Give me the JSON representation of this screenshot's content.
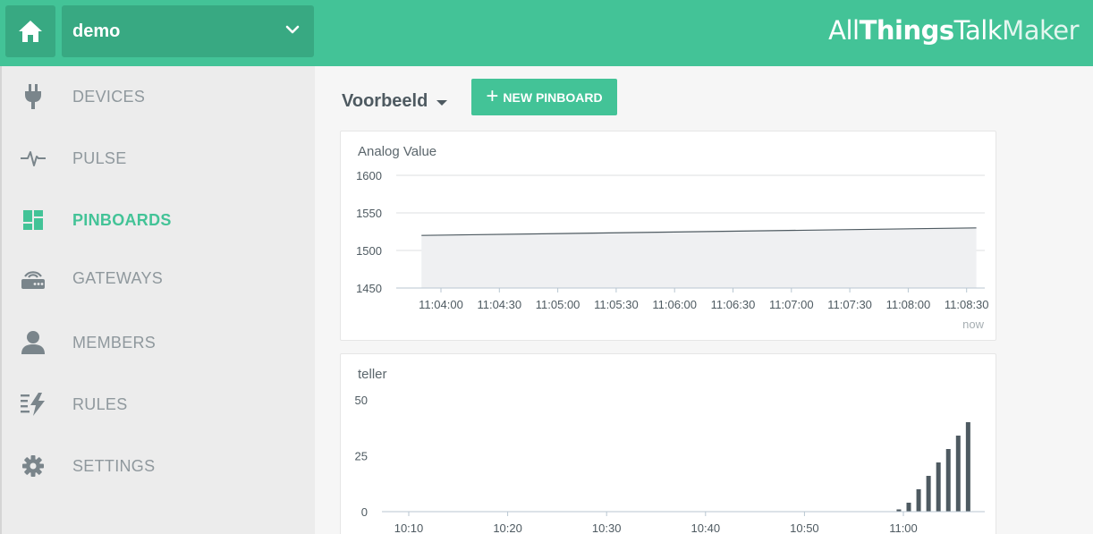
{
  "header": {
    "ground": "demo",
    "brand": {
      "part1": "All",
      "part2": "Things",
      "part3": "Talk",
      "part4": "Maker"
    },
    "brand_color": "#43c397"
  },
  "sidebar": {
    "items": [
      {
        "label": "DEVICES",
        "icon": "plug-icon",
        "active": false
      },
      {
        "label": "PULSE",
        "icon": "pulse-icon",
        "active": false
      },
      {
        "label": "PINBOARDS",
        "icon": "dashboard-icon",
        "active": true
      },
      {
        "label": "GATEWAYS",
        "icon": "gateway-icon",
        "active": false
      },
      {
        "label": "MEMBERS",
        "icon": "user-icon",
        "active": false
      },
      {
        "label": "RULES",
        "icon": "rules-icon",
        "active": false
      },
      {
        "label": "SETTINGS",
        "icon": "gear-icon",
        "active": false
      }
    ]
  },
  "main": {
    "pinboard": "Voorbeeld",
    "new_pinboard_label": "NEW PINBOARD",
    "cards": [
      {
        "title": "Analog Value",
        "footer": "now"
      },
      {
        "title": "teller"
      }
    ]
  },
  "chart_data": [
    {
      "type": "area",
      "title": "Analog Value",
      "x_ticks": [
        "11:04:00",
        "11:04:30",
        "11:05:00",
        "11:05:30",
        "11:06:00",
        "11:06:30",
        "11:07:00",
        "11:07:30",
        "11:08:00",
        "11:08:30"
      ],
      "y_ticks": [
        1450,
        1500,
        1550,
        1600
      ],
      "ylim": [
        1450,
        1600
      ],
      "x": [
        "11:03:50",
        "11:08:35"
      ],
      "values": [
        1520,
        1530
      ],
      "xlabel": "",
      "ylabel": "",
      "grid": true,
      "line_color": "#4e5a61",
      "fill_color": "#eff0f2"
    },
    {
      "type": "bar",
      "title": "teller",
      "x_ticks": [
        "10:10",
        "10:20",
        "10:30",
        "10:40",
        "10:50",
        "11:00"
      ],
      "y_ticks": [
        0,
        25,
        50
      ],
      "ylim": [
        0,
        50
      ],
      "x_minutes": [
        1,
        2,
        3,
        4,
        5,
        6,
        7
      ],
      "x_start": "11:00",
      "values": [
        1,
        4,
        10,
        16,
        22,
        28,
        34,
        40
      ],
      "xlabel": "",
      "ylabel": "",
      "grid": false,
      "bar_color": "#4e5a61"
    }
  ]
}
